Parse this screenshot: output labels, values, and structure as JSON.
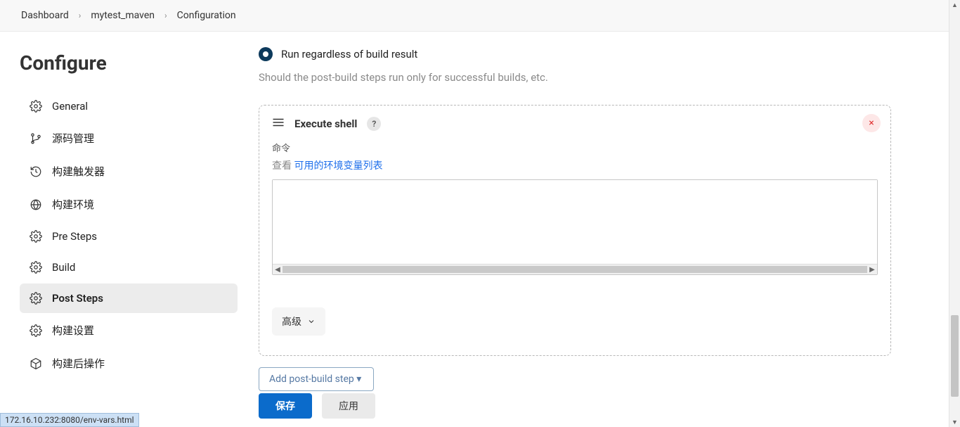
{
  "breadcrumb": {
    "items": [
      {
        "label": "Dashboard"
      },
      {
        "label": "mytest_maven"
      },
      {
        "label": "Configuration"
      }
    ]
  },
  "sidebar": {
    "title": "Configure",
    "items": [
      {
        "label": "General"
      },
      {
        "label": "源码管理"
      },
      {
        "label": "构建触发器"
      },
      {
        "label": "构建环境"
      },
      {
        "label": "Pre Steps"
      },
      {
        "label": "Build"
      },
      {
        "label": "Post Steps"
      },
      {
        "label": "构建设置"
      },
      {
        "label": "构建后操作"
      }
    ],
    "active_index": 6
  },
  "main": {
    "radio_label": "Run regardless of build result",
    "help_text": "Should the post-build steps run only for successful builds, etc.",
    "card": {
      "title": "Execute shell",
      "help_symbol": "?",
      "close_symbol": "×",
      "field_label": "命令",
      "view_prefix": "查看 ",
      "env_vars_link": "可用的环境变量列表",
      "command_value": "",
      "advanced_label": "高级"
    },
    "add_step_label": "Add post-build step ▾"
  },
  "footer": {
    "save_label": "保存",
    "apply_label": "应用"
  },
  "status_url": "172.16.10.232:8080/env-vars.html"
}
